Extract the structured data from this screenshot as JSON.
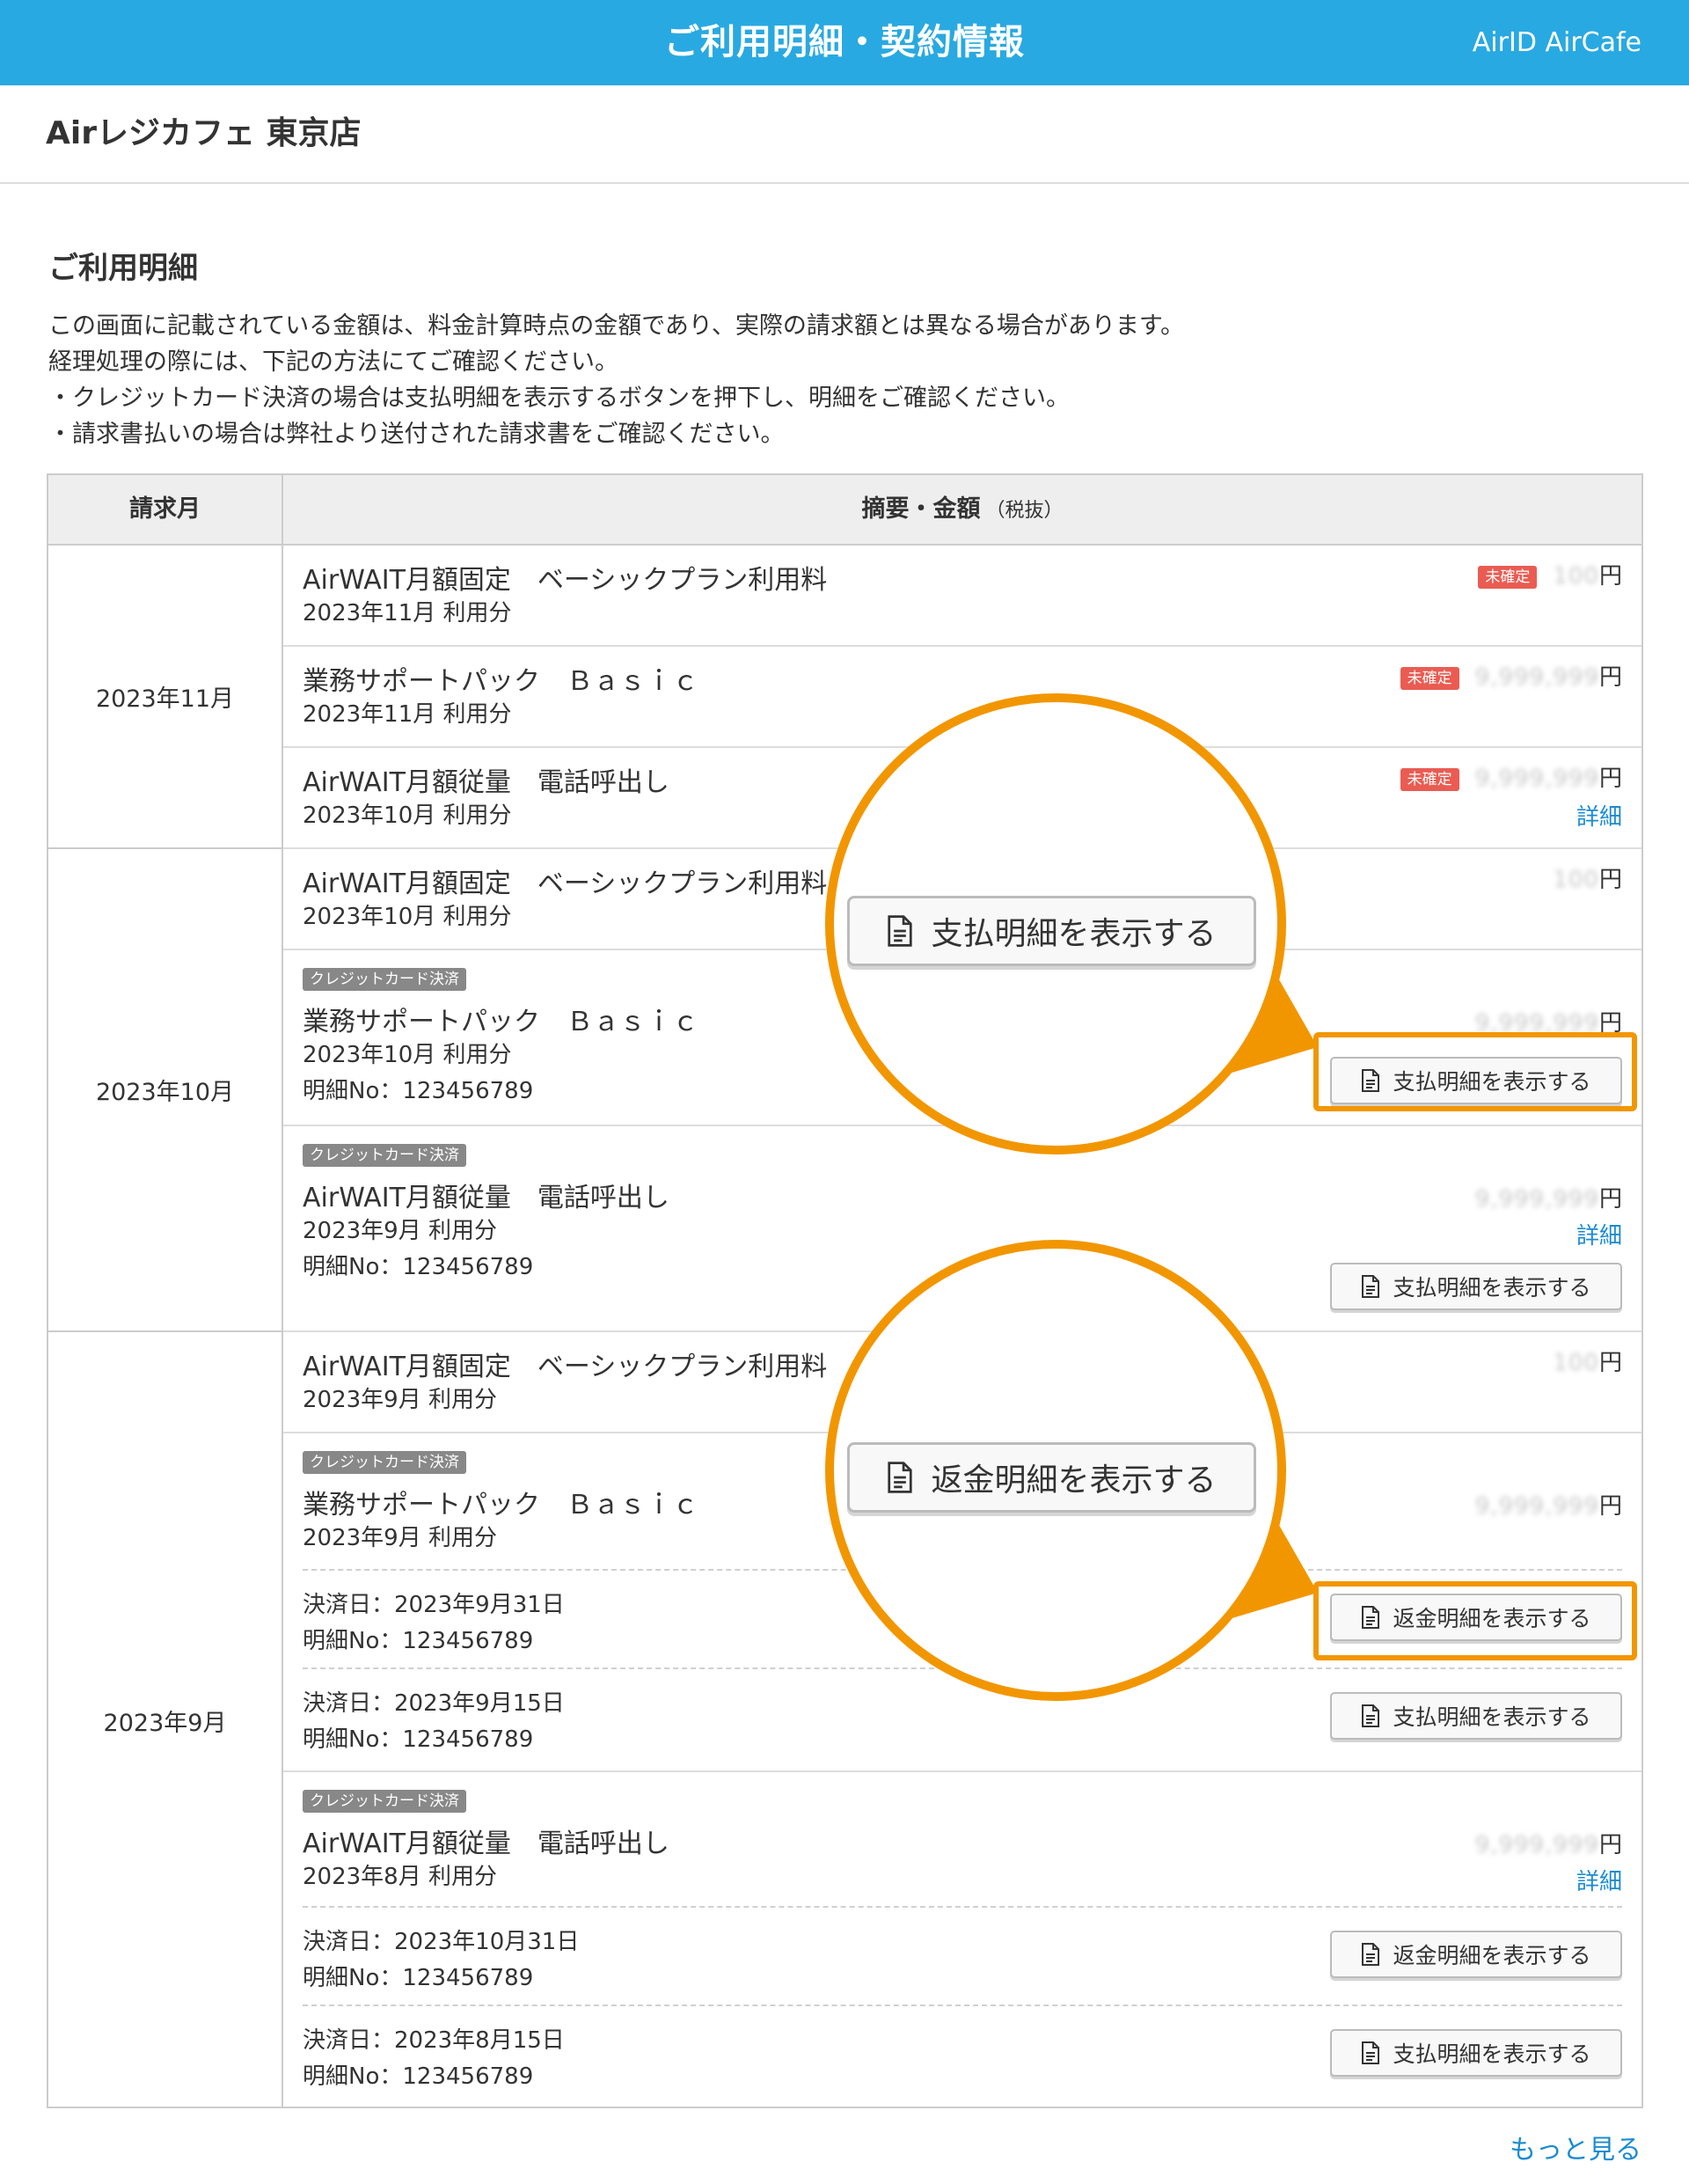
{
  "header": {
    "title": "ご利用明細・契約情報",
    "account": "AirID AirCafe"
  },
  "store": {
    "name": "Airレジカフェ 東京店"
  },
  "section": {
    "title": "ご利用明細",
    "notice": [
      "この画面に記載されている金額は、料金計算時点の金額であり、実際の請求額とは異なる場合があります。",
      "経理処理の際には、下記の方法にてご確認ください。",
      "・クレジットカード決済の場合は支払明細を表示するボタンを押下し、明細をご確認ください。",
      "・請求書払いの場合は弊社より送付された請求書をご確認ください。"
    ]
  },
  "table": {
    "col_month": "請求月",
    "col_desc": "摘要・金額",
    "col_desc_note": "（税抜）",
    "months": [
      "2023年11月",
      "2023年10月",
      "2023年9月"
    ],
    "rows": [
      {
        "name": "AirWAIT月額固定　ベーシックプラン利用料",
        "period": "2023年11月 利用分",
        "status": "未確定",
        "amount": "100",
        "unit": "円"
      },
      {
        "name": "業務サポートパック　Ｂａｓｉｃ",
        "period": "2023年11月 利用分",
        "status": "未確定",
        "amount": "9,999,999",
        "unit": "円"
      },
      {
        "name": "AirWAIT月額従量　電話呼出し",
        "period": "2023年10月 利用分",
        "status": "未確定",
        "amount": "9,999,999",
        "unit": "円",
        "detail": "詳細"
      },
      {
        "name": "AirWAIT月額固定　ベーシックプラン利用料",
        "period": "2023年10月 利用分",
        "amount": "100",
        "unit": "円"
      },
      {
        "tag": "クレジットカード決済",
        "name": "業務サポートパック　Ｂａｓｉｃ",
        "period": "2023年10月 利用分",
        "ref": "明細No：123456789",
        "amount": "9,999,999",
        "unit": "円",
        "button": "支払明細を表示する"
      },
      {
        "tag": "クレジットカード決済",
        "name": "AirWAIT月額従量　電話呼出し",
        "period": "2023年9月 利用分",
        "ref": "明細No：123456789",
        "amount": "9,999,999",
        "unit": "円",
        "detail": "詳細",
        "button": "支払明細を表示する"
      },
      {
        "name": "AirWAIT月額固定　ベーシックプラン利用料",
        "period": "2023年9月 利用分",
        "amount": "100",
        "unit": "円"
      },
      {
        "tag": "クレジットカード決済",
        "name": "業務サポートパック　Ｂａｓｉｃ",
        "period": "2023年9月 利用分",
        "amount": "9,999,999",
        "unit": "円",
        "payments": [
          {
            "date": "決済日：2023年9月31日",
            "ref": "明細No：123456789",
            "button": "返金明細を表示する"
          },
          {
            "date": "決済日：2023年9月15日",
            "ref": "明細No：123456789",
            "button": "支払明細を表示する"
          }
        ]
      },
      {
        "tag": "クレジットカード決済",
        "name": "AirWAIT月額従量　電話呼出し",
        "period": "2023年8月 利用分",
        "amount": "9,999,999",
        "unit": "円",
        "detail": "詳細",
        "payments": [
          {
            "date": "決済日：2023年10月31日",
            "ref": "明細No：123456789",
            "button": "返金明細を表示する"
          },
          {
            "date": "決済日：2023年8月15日",
            "ref": "明細No：123456789",
            "button": "支払明細を表示する"
          }
        ]
      }
    ]
  },
  "callouts": {
    "pay_button": "支払明細を表示する",
    "refund_button": "返金明細を表示する"
  },
  "more_link": "もっと見る",
  "colors": {
    "header_bg": "#29a9e1",
    "highlight": "#f29600",
    "status_bg": "#ea5c52",
    "link": "#1a8bd1",
    "tag_bg": "#888888"
  }
}
